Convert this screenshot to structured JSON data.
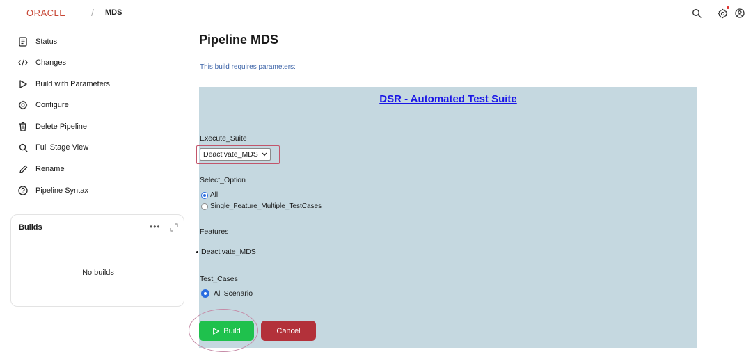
{
  "header": {
    "brand": "ORACLE",
    "separator": "/",
    "breadcrumb": "MDS",
    "icons": [
      "search-icon",
      "gear-icon",
      "user-icon"
    ]
  },
  "sidebar": {
    "items": [
      {
        "label": "Status",
        "icon": "document-icon"
      },
      {
        "label": "Changes",
        "icon": "code-icon"
      },
      {
        "label": "Build with Parameters",
        "icon": "play-icon"
      },
      {
        "label": "Configure",
        "icon": "gear-icon"
      },
      {
        "label": "Delete Pipeline",
        "icon": "trash-icon"
      },
      {
        "label": "Full Stage View",
        "icon": "search-icon"
      },
      {
        "label": "Rename",
        "icon": "pencil-icon"
      },
      {
        "label": "Pipeline Syntax",
        "icon": "help-icon"
      }
    ],
    "builds": {
      "title": "Builds",
      "more": "•••",
      "empty": "No builds"
    }
  },
  "main": {
    "title": "Pipeline MDS",
    "note": "This build requires parameters:",
    "panel": {
      "heading": "DSR - Automated Test Suite",
      "execute_suite": {
        "label": "Execute_Suite",
        "value": "Deactivate_MDS"
      },
      "select_option": {
        "label": "Select_Option",
        "options": [
          "All",
          "Single_Feature_Multiple_TestCases"
        ],
        "selected": "All"
      },
      "features": {
        "label": "Features",
        "items": [
          "Deactivate_MDS"
        ]
      },
      "test_cases": {
        "label": "Test_Cases",
        "option": "All Scenario"
      }
    },
    "buttons": {
      "build": "Build",
      "cancel": "Cancel"
    }
  },
  "colors": {
    "brand": "#c74634",
    "panel": "#c5d8e0",
    "link": "#1a16e6",
    "build": "#1fc14d",
    "cancel": "#b3313a",
    "note": "#3d64a8"
  }
}
